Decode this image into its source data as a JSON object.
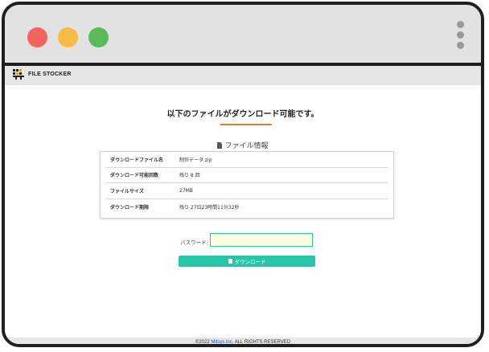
{
  "window": {
    "controls": [
      "close-dot",
      "minimize-dot",
      "maximize-dot"
    ],
    "colors": {
      "close": "#f2645d",
      "minimize": "#f8bb44",
      "maximize": "#5bbb5b"
    }
  },
  "header": {
    "logo_text": "FILE STOCKER"
  },
  "main": {
    "title": "以下のファイルがダウンロード可能です。",
    "section_title": "ファイル情報",
    "rows": [
      {
        "label": "ダウンロードファイル名",
        "value": "制作データ.zip"
      },
      {
        "label": "ダウンロード可能回数",
        "value": "残り 8 回"
      },
      {
        "label": "ファイルサイズ",
        "value": "27MB"
      },
      {
        "label": "ダウンロード期限",
        "value": "残り 27日23時間11分32秒"
      }
    ],
    "password_label": "パスワード：",
    "password_value": "",
    "download_button": "ダウンロード"
  },
  "footer": {
    "prefix": "©2022 ",
    "company": "Mitsys inc.",
    "suffix": " ALL RIGHTS RESERVED"
  },
  "colors": {
    "accent": "#26c6a8",
    "underline": "#e07a2e",
    "input_bg": "#fdfde0"
  }
}
